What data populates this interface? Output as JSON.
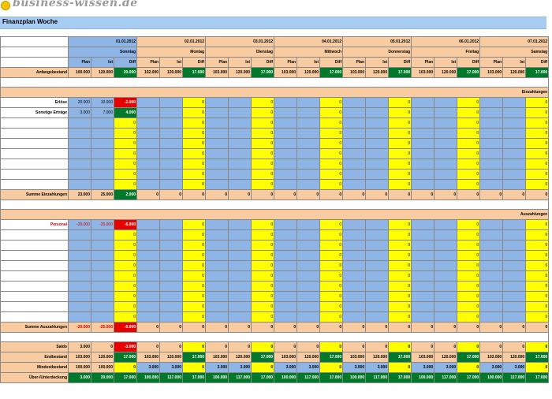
{
  "brand": {
    "logo_icon": "smiley-logo-icon",
    "text": "business-wissen.de"
  },
  "title": "Finanzplan Woche",
  "days": [
    {
      "date": "01.01.2012",
      "name": "Sonntag"
    },
    {
      "date": "02.01.2012",
      "name": "Montag"
    },
    {
      "date": "03.01.2012",
      "name": "Dienstag"
    },
    {
      "date": "04.01.2012",
      "name": "Mittwoch"
    },
    {
      "date": "05.01.2012",
      "name": "Donnerstag"
    },
    {
      "date": "06.01.2012",
      "name": "Freitag"
    },
    {
      "date": "07.01.2012",
      "name": "Samstag"
    }
  ],
  "subheaders": [
    "Plan",
    "Ist",
    "Diff"
  ],
  "rows": {
    "anfangsbestand": {
      "label": "Anfangsbestand",
      "values": [
        [
          "100.000",
          "120.000",
          "20.000"
        ],
        [
          "102.000",
          "120.000",
          "17.000"
        ],
        [
          "103.000",
          "120.000",
          "17.000"
        ],
        [
          "103.000",
          "120.000",
          "17.000"
        ],
        [
          "103.000",
          "120.000",
          "17.000"
        ],
        [
          "103.000",
          "120.000",
          "17.000"
        ],
        [
          "103.000",
          "120.000",
          "17.000"
        ]
      ]
    },
    "einzahlungen_header": "Einzahlungen",
    "erloese": {
      "label": "Erlöse",
      "values": [
        "20.000",
        "10.000",
        "-2.000"
      ]
    },
    "sonstige": {
      "label": "Sonstige Erträge",
      "values": [
        "3.000",
        "7.000",
        "4.000"
      ]
    },
    "summe_einzahlungen": {
      "label": "Summe Einzahlungen",
      "values": [
        [
          "23.000",
          "25.000",
          "2.000"
        ],
        [
          "0",
          "0",
          "0"
        ],
        [
          "0",
          "0",
          "0"
        ],
        [
          "0",
          "0",
          "0"
        ],
        [
          "0",
          "0",
          "0"
        ],
        [
          "0",
          "0",
          "0"
        ],
        [
          "0",
          "0",
          "0"
        ]
      ]
    },
    "auszahlungen_header": "Auszahlungen",
    "personal": {
      "label": "Personal",
      "values": [
        "-20.000",
        "-25.000",
        "-5.000"
      ]
    },
    "summe_auszahlungen": {
      "label": "Summe Auszahlungen",
      "values": [
        [
          "-20.000",
          "-25.000",
          "-5.000"
        ],
        [
          "0",
          "0",
          "0"
        ],
        [
          "0",
          "0",
          "0"
        ],
        [
          "0",
          "0",
          "0"
        ],
        [
          "0",
          "0",
          "0"
        ],
        [
          "0",
          "0",
          "0"
        ],
        [
          "0",
          "0",
          "0"
        ]
      ]
    },
    "saldo": {
      "label": "Saldo",
      "values": [
        [
          "3.000",
          "0",
          "-3.000"
        ],
        [
          "0",
          "0",
          "0"
        ],
        [
          "0",
          "0",
          "0"
        ],
        [
          "0",
          "0",
          "0"
        ],
        [
          "0",
          "0",
          "0"
        ],
        [
          "0",
          "0",
          "0"
        ],
        [
          "0",
          "0",
          "0"
        ]
      ]
    },
    "endbestand": {
      "label": "Endbestand",
      "values": [
        [
          "103.000",
          "120.000",
          "17.000"
        ],
        [
          "103.000",
          "120.000",
          "17.000"
        ],
        [
          "103.000",
          "120.000",
          "17.000"
        ],
        [
          "103.000",
          "120.000",
          "17.000"
        ],
        [
          "103.000",
          "120.000",
          "17.000"
        ],
        [
          "103.000",
          "120.000",
          "17.000"
        ],
        [
          "103.000",
          "120.000",
          "17.000"
        ]
      ]
    },
    "mindestbestand": {
      "label": "Mindestbestand",
      "values": [
        [
          "100.000",
          "100.000",
          "0"
        ],
        [
          "3.000",
          "3.000",
          "0"
        ],
        [
          "3.000",
          "3.000",
          "0"
        ],
        [
          "3.000",
          "3.000",
          "0"
        ],
        [
          "3.000",
          "3.000",
          "0"
        ],
        [
          "3.000",
          "3.000",
          "0"
        ],
        [
          "3.000",
          "3.000",
          "0"
        ]
      ]
    },
    "ueber": {
      "label": "Über-/Unterdeckung",
      "values": [
        [
          "3.000",
          "20.000",
          "17.000"
        ],
        [
          "100.000",
          "117.000",
          "17.000"
        ],
        [
          "100.000",
          "117.000",
          "17.000"
        ],
        [
          "100.000",
          "117.000",
          "17.000"
        ],
        [
          "100.000",
          "117.000",
          "17.000"
        ],
        [
          "100.000",
          "117.000",
          "17.000"
        ],
        [
          "100.000",
          "117.000",
          "17.000"
        ]
      ]
    }
  },
  "empty_zero": "0"
}
